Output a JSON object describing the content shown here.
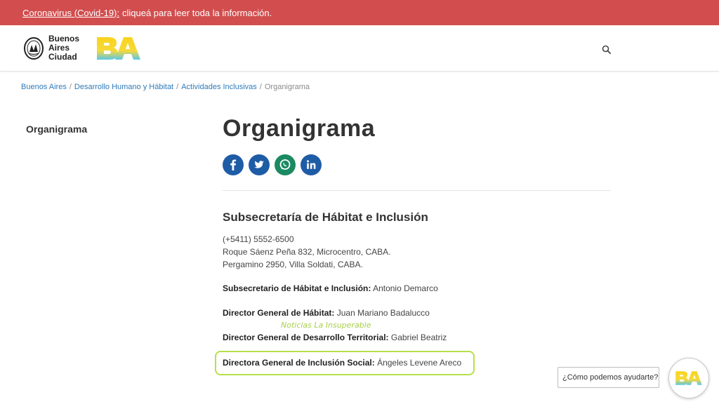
{
  "alert": {
    "link_text": "Coronavirus (Covid-19):",
    "message": "cliqueá para leer toda la información."
  },
  "header": {
    "brand_lines": [
      "Buenos",
      "Aires",
      "Ciudad"
    ],
    "ba_logo_text": "BA",
    "colors": {
      "ba_yellow": "#f9d41c",
      "ba_cyan": "#5bc7e8"
    }
  },
  "breadcrumb": {
    "items": [
      "Buenos Aires",
      "Desarrollo Humano y Hábitat",
      "Actividades Inclusivas"
    ],
    "current": "Organigrama",
    "separator": "/"
  },
  "sidebar": {
    "item": "Organigrama"
  },
  "main": {
    "title": "Organigrama",
    "share_icons": [
      "facebook-icon",
      "twitter-icon",
      "whatsapp-icon",
      "linkedin-icon"
    ],
    "section_title": "Subsecretaría de Hábitat e Inclusión",
    "contact_lines": [
      "(+5411) 5552-6500",
      "Roque Sáenz Peña 832, Microcentro, CABA.",
      "Pergamino 2950, Villa Soldati, CABA."
    ],
    "people": [
      {
        "role": "Subsecretario de Hábitat e Inclusión:",
        "name": "Antonio Demarco"
      },
      {
        "role": "Director General de Hábitat:",
        "name": "Juan Mariano Badalucco"
      },
      {
        "role": "Director General de Desarrollo Territorial:",
        "name": "Gabriel Beatriz"
      },
      {
        "role": "Directora General de Inclusión Social:",
        "name": "Ángeles Levene Areco"
      }
    ],
    "watermark": "Noticias La Insuperable",
    "highlight_color": "#b6e04a"
  },
  "chat": {
    "prompt": "¿Cómo podemos ayudarte?",
    "logo_text": "BA"
  }
}
